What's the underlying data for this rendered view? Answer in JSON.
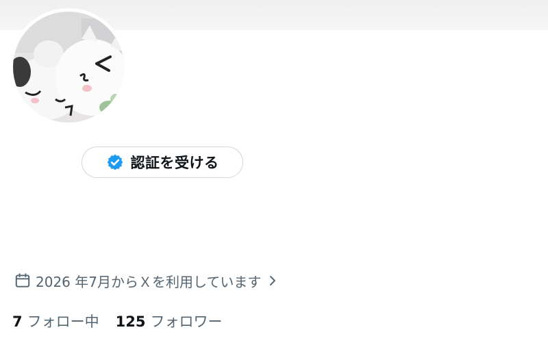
{
  "profile": {
    "verify_button_label": "認証を受ける",
    "joined_text": "2026 年7月からＸを利用しています",
    "following_count": "7",
    "following_label": "フォロー中",
    "followers_count": "125",
    "followers_label": "フォロワー"
  },
  "icons": {
    "verify": "verified-badge-icon",
    "calendar": "calendar-icon",
    "chevron": "chevron-right-icon"
  },
  "colors": {
    "accent": "#1d9bf0",
    "muted_text": "#536471",
    "primary_text": "#0f1419",
    "border": "#cfd9de"
  }
}
